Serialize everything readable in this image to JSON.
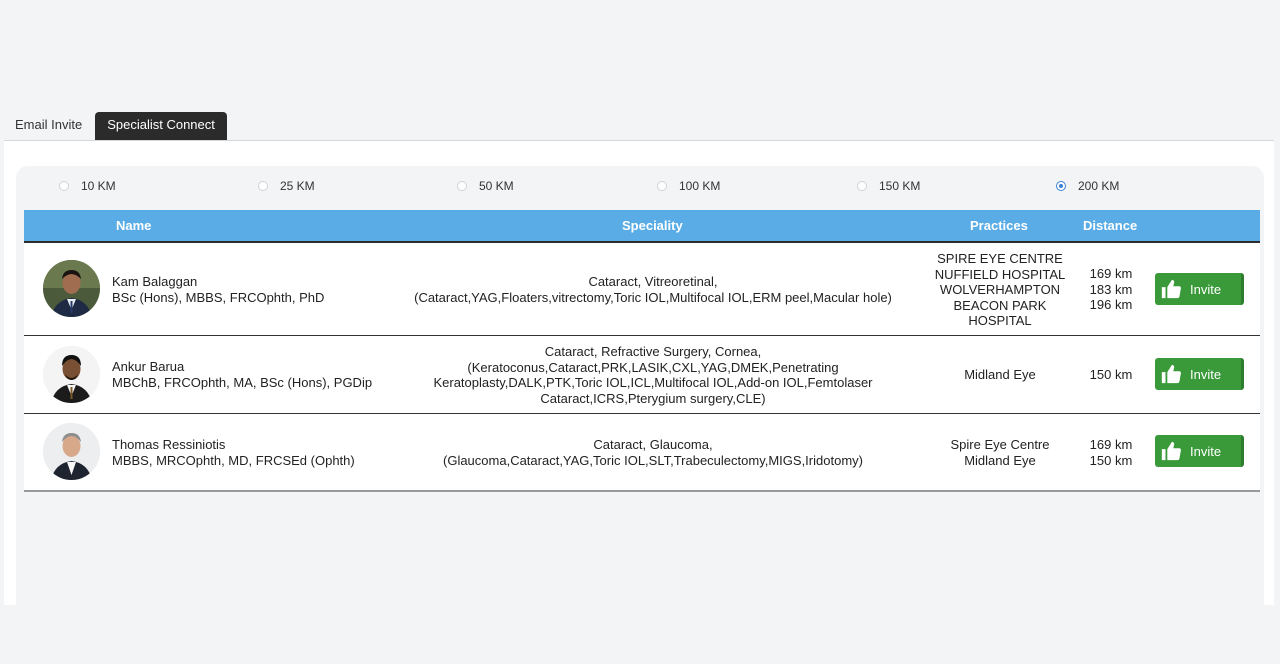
{
  "tabs": [
    {
      "label": "Email Invite",
      "active": false
    },
    {
      "label": "Specialist Connect",
      "active": true
    }
  ],
  "distance_options": [
    {
      "label": "10 KM",
      "selected": false
    },
    {
      "label": "25 KM",
      "selected": false
    },
    {
      "label": "50 KM",
      "selected": false
    },
    {
      "label": "100 KM",
      "selected": false
    },
    {
      "label": "150 KM",
      "selected": false
    },
    {
      "label": "200 KM",
      "selected": true
    }
  ],
  "table": {
    "header_color": "#5aace6",
    "headers": {
      "name": "Name",
      "speciality": "Speciality",
      "practices": "Practices",
      "distance": "Distance"
    },
    "invite_label": "Invite",
    "invite_color": "#3a9a3a",
    "rows": [
      {
        "name": "Kam Balaggan",
        "credentials": "BSc (Hons), MBBS, FRCOphth, PhD",
        "speciality": [
          "Cataract, Vitreoretinal,",
          "(Cataract,YAG,Floaters,vitrectomy,Toric IOL,Multifocal IOL,ERM peel,Macular hole)"
        ],
        "practices": [
          "SPIRE EYE CENTRE",
          "NUFFIELD HOSPITAL",
          "WOLVERHAMPTON",
          "BEACON PARK",
          "HOSPITAL"
        ],
        "distances": [
          "169 km",
          "183 km",
          "196 km"
        ]
      },
      {
        "name": "Ankur Barua",
        "credentials": "MBChB, FRCOphth, MA, BSc (Hons), PGDip",
        "speciality": [
          "Cataract, Refractive Surgery, Cornea,",
          "(Keratoconus,Cataract,PRK,LASIK,CXL,YAG,DMEK,Penetrating",
          "Keratoplasty,DALK,PTK,Toric IOL,ICL,Multifocal IOL,Add-on IOL,Femtolaser",
          "Cataract,ICRS,Pterygium surgery,CLE)"
        ],
        "practices": [
          "Midland Eye"
        ],
        "distances": [
          "150 km"
        ]
      },
      {
        "name": "Thomas Ressiniotis",
        "credentials": "MBBS, MRCOphth, MD, FRCSEd (Ophth)",
        "speciality": [
          "Cataract, Glaucoma,",
          "(Glaucoma,Cataract,YAG,Toric IOL,SLT,Trabeculectomy,MIGS,Iridotomy)"
        ],
        "practices": [
          "Spire Eye Centre",
          "Midland Eye"
        ],
        "distances": [
          "169 km",
          "150 km"
        ]
      }
    ]
  }
}
